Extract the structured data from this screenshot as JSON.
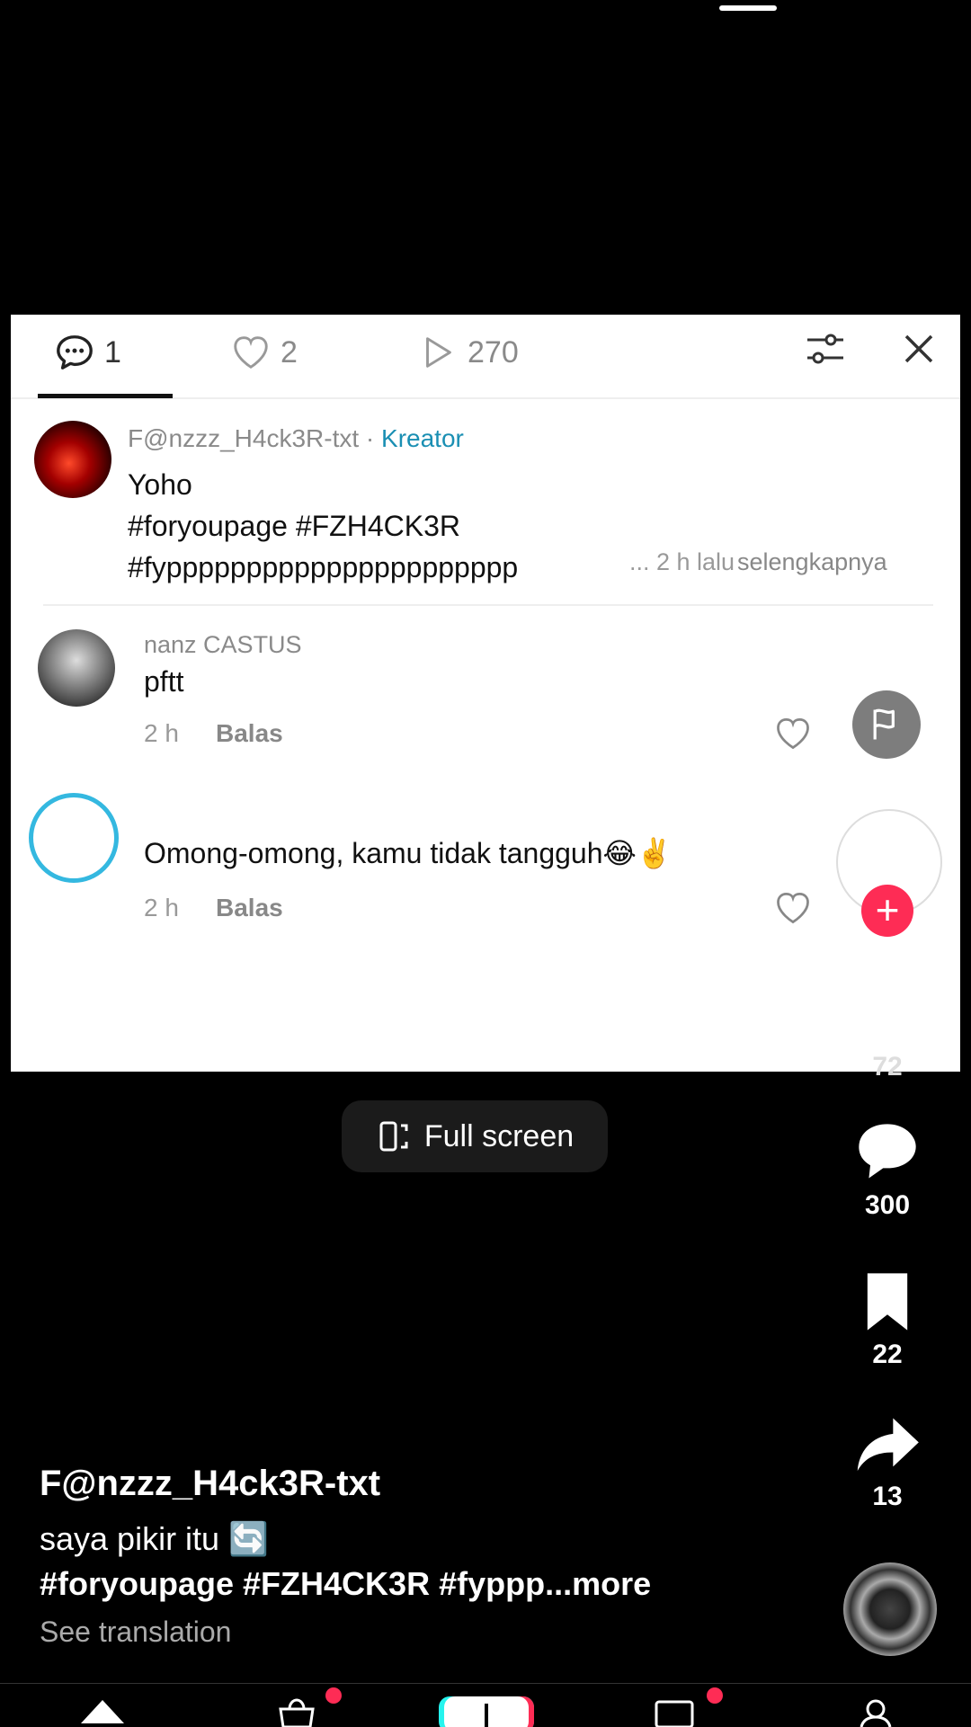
{
  "tabs": {
    "comments_count": "1",
    "likes_count": "2",
    "views_count": "270"
  },
  "creator_comment": {
    "username": "F@nzzz_H4ck3R-txt",
    "separator": " · ",
    "tag": "Kreator",
    "line1": "Yoho",
    "line2": "#foryoupage #FZH4CK3R",
    "line3": "#fypppppppppppppppppppppp",
    "meta": "... 2 h lalu",
    "see_more": "selengkapnya"
  },
  "comments": [
    {
      "name": "nanz CASTUS",
      "text": "pftt",
      "time": "2 h",
      "reply": "Balas"
    },
    {
      "name": "",
      "text": "Omong-omong, kamu tidak tangguh😂✌️",
      "time": "2 h",
      "reply": "Balas"
    }
  ],
  "side": {
    "like_count": "72",
    "comment_count": "300",
    "save_count": "22",
    "share_count": "13",
    "follow_symbol": "+"
  },
  "fullscreen_label": "Full screen",
  "caption": {
    "author": "F@nzzz_H4ck3R-txt",
    "text": "saya pikir itu 🔄",
    "hashtags": "#foryoupage #FZH4CK3R #fyppp...more",
    "translate": "See translation"
  },
  "colors": {
    "accent": "#fe2c55",
    "creator_tag": "#1a8fb3",
    "ring": "#34b8e0"
  },
  "icons": [
    "comment-icon",
    "heart-icon",
    "play-icon",
    "filter-icon",
    "close-icon",
    "flag-icon",
    "bookmark-icon",
    "share-icon",
    "fullscreen-icon",
    "home-icon",
    "shop-icon",
    "create-icon",
    "inbox-icon",
    "profile-icon"
  ]
}
